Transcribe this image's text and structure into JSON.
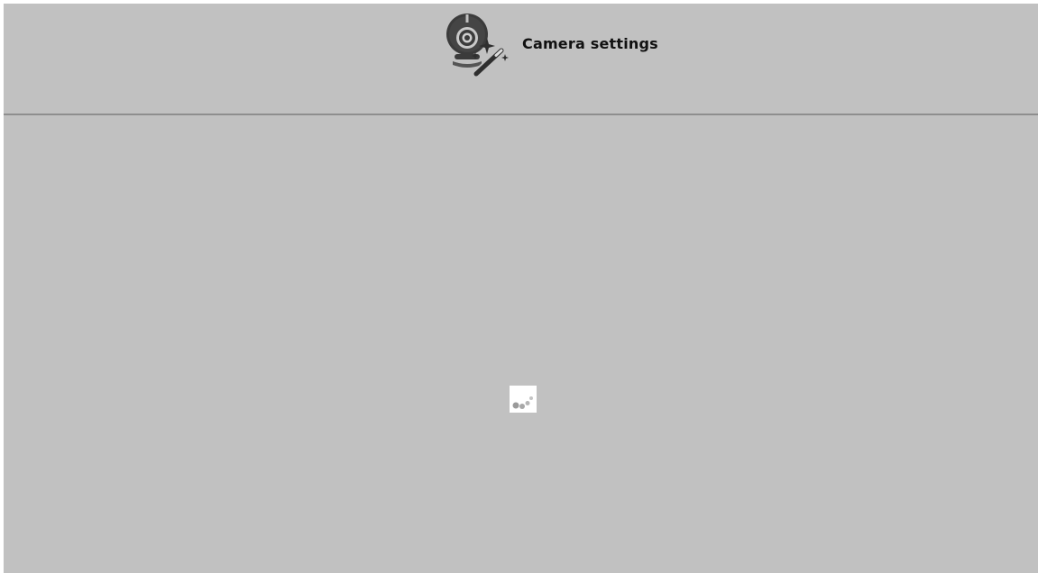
{
  "header": {
    "icon": "camera-settings-icon",
    "title": "Camera settings"
  },
  "content": {
    "loading_indicator": "loading-spinner-icon"
  },
  "colors": {
    "window_background": "#c1c1c1",
    "divider": "#8e8e8e",
    "icon_dark": "#3a3a3a",
    "title_text": "#111111"
  }
}
